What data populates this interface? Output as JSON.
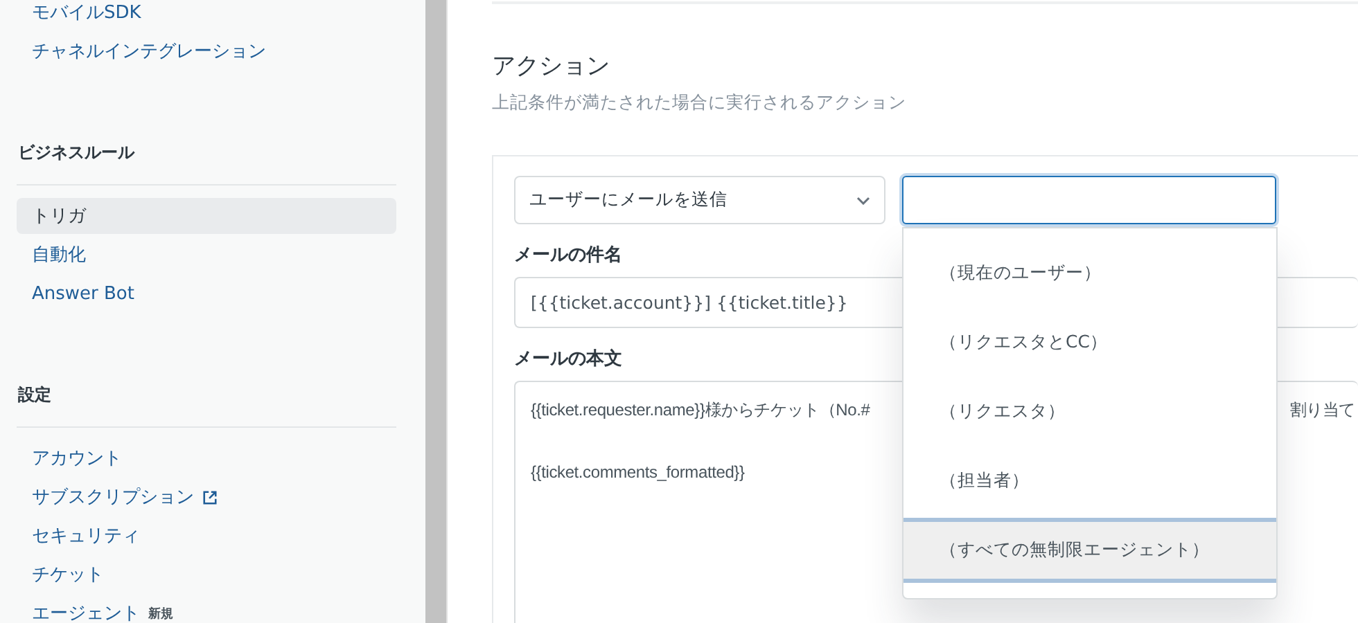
{
  "sidebar": {
    "items_top": [
      {
        "label": "モバイルSDK",
        "selected": false
      },
      {
        "label": "チャネルインテグレーション",
        "selected": false
      }
    ],
    "sections": [
      {
        "heading": "ビジネスルール",
        "items": [
          {
            "label": "トリガ",
            "selected": true
          },
          {
            "label": "自動化",
            "selected": false
          },
          {
            "label": "Answer Bot",
            "selected": false
          }
        ]
      },
      {
        "heading": "設定",
        "items": [
          {
            "label": "アカウント",
            "selected": false
          },
          {
            "label": "サブスクリプション",
            "selected": false,
            "external": true
          },
          {
            "label": "セキュリティ",
            "selected": false
          },
          {
            "label": "チケット",
            "selected": false
          },
          {
            "label": "エージェント",
            "selected": false,
            "badge": "新規"
          }
        ]
      }
    ]
  },
  "section": {
    "title": "アクション",
    "subtitle": "上記条件が満たされた場合に実行されるアクション"
  },
  "action": {
    "select": "ユーザーにメールを送信",
    "options": [
      {
        "label": "（現在のユーザー）",
        "selected": false
      },
      {
        "label": "（リクエスタとCC）",
        "selected": false
      },
      {
        "label": "（リクエスタ）",
        "selected": false
      },
      {
        "label": "（担当者）",
        "selected": false
      },
      {
        "label": "（すべての無制限エージェント）",
        "selected": true
      }
    ]
  },
  "subject": {
    "label": "メールの件名",
    "value": "[{{ticket.account}}] {{ticket.title}}"
  },
  "body": {
    "label": "メールの本文",
    "line_1_start": "{{ticket.requester.name}}様からチケット（No.#",
    "line_1_end": "割り当て",
    "line_2": "{{ticket.comments_formatted}}"
  }
}
